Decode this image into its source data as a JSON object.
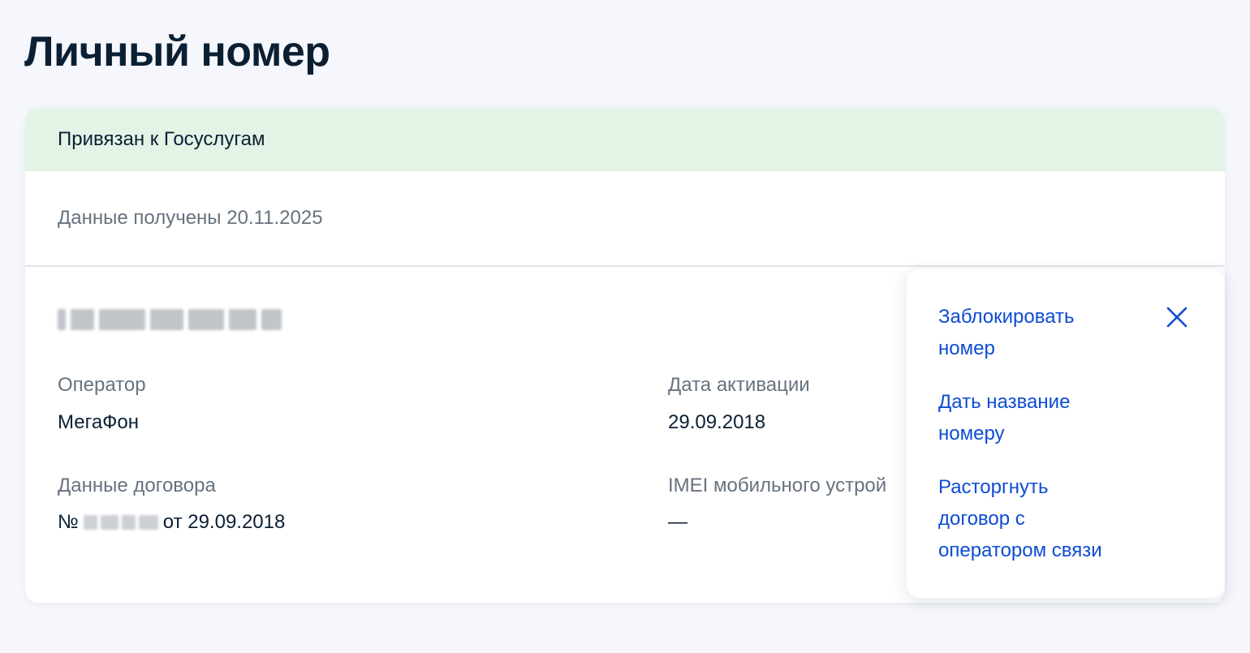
{
  "page": {
    "title": "Личный номер"
  },
  "card": {
    "status": "Привязан к Госуслугам",
    "received": "Данные получены 20.11.2025",
    "fields": {
      "operator_label": "Оператор",
      "operator_value": "МегаФон",
      "activation_label": "Дата активации",
      "activation_value": "29.09.2018",
      "contract_label": "Данные договора",
      "contract_prefix": "№",
      "contract_suffix": "от 29.09.2018",
      "imei_label": "IMEI мобильного устрой",
      "imei_value": "—"
    }
  },
  "menu": {
    "items": [
      {
        "line1": "Заблокировать",
        "line2": "номер"
      },
      {
        "line1": "Дать название",
        "line2": "номеру"
      },
      {
        "line1": "Расторгнуть",
        "line2": "договор с",
        "line3": "оператором связи"
      }
    ],
    "close_icon": "close-icon"
  },
  "colors": {
    "link": "#0d4cd3",
    "status_bg": "#e3f4e6",
    "muted_text": "#66727f",
    "primary_text": "#0b1f33"
  }
}
